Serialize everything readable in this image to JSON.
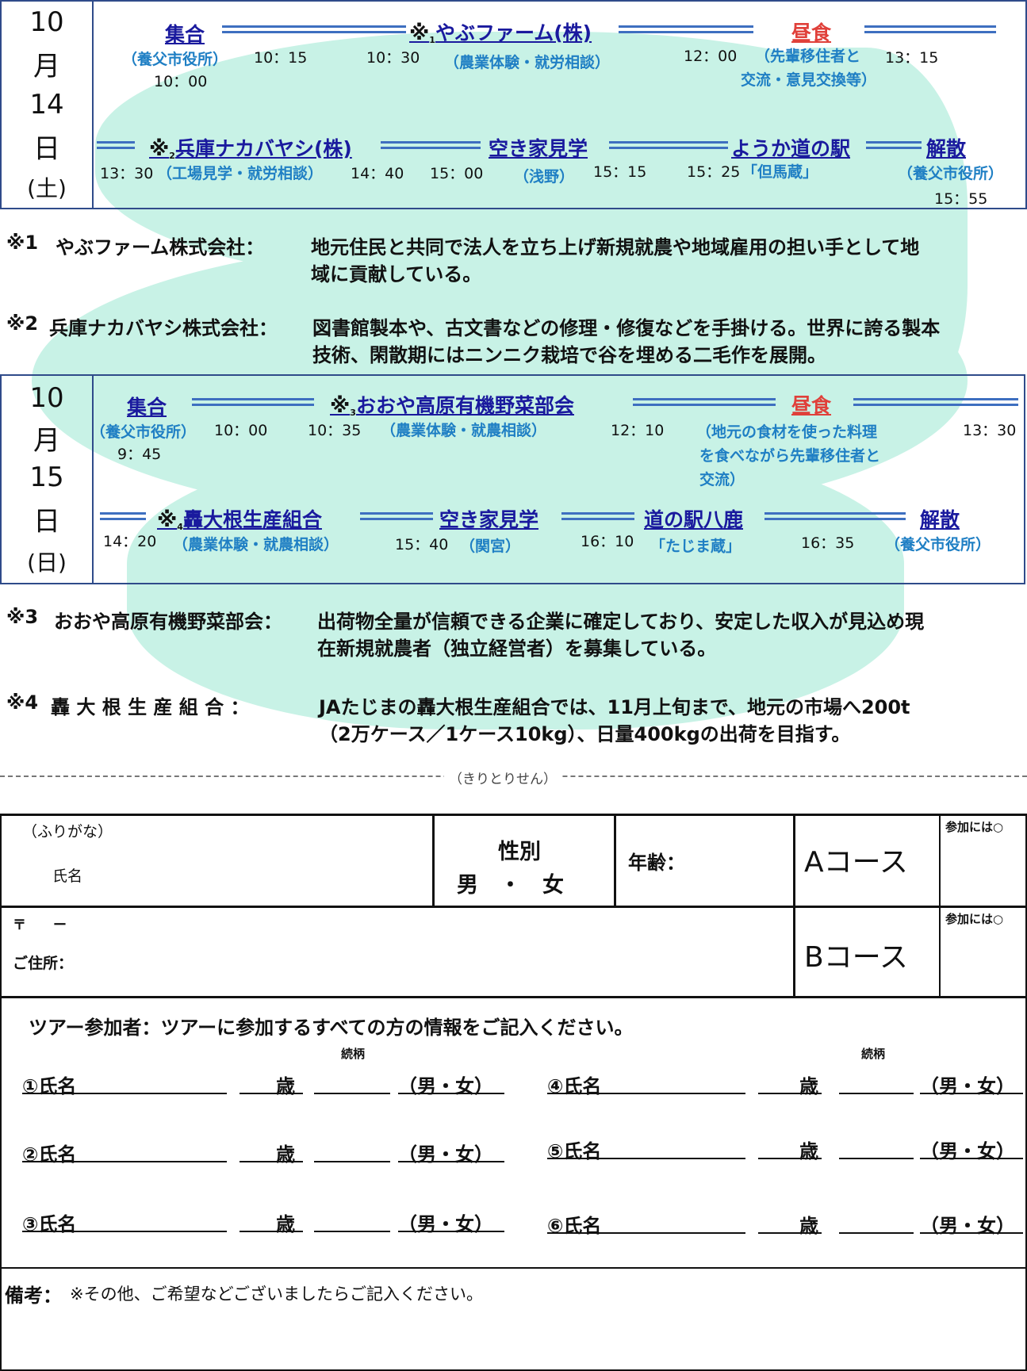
{
  "day1": {
    "date": {
      "month_num": "10",
      "month_char": "月",
      "day_num": "14",
      "day_char": "日",
      "weekday": "(土)"
    },
    "row1": {
      "stop1": {
        "label": "集合",
        "sub": "（養父市役所）",
        "time_start": "10：00",
        "time_end": "10：15"
      },
      "stop2": {
        "asterisk": "※",
        "num": "1",
        "label": "やぶファーム(株)",
        "sub": "（農業体験・就労相談）",
        "time_arrive": "10：30",
        "time_end": "12：00"
      },
      "stop3": {
        "label": "昼食",
        "sub_line1": "（先輩移住者と",
        "sub_line2": "交流・意見交換等）",
        "time_end": "13：15"
      }
    },
    "row2": {
      "stop1": {
        "asterisk": "※",
        "num": "2",
        "label": "兵庫ナカバヤシ(株)",
        "sub": "（工場見学・就労相談）",
        "time_start": "13：30",
        "time_end": "14：40"
      },
      "stop2": {
        "label": "空き家見学",
        "sub": "（浅野）",
        "time_start": "15：00",
        "time_end": "15：15"
      },
      "stop3": {
        "label": "ようか道の駅",
        "sub": "「但馬蔵」",
        "time_start": "15：25"
      },
      "stop4": {
        "label": "解散",
        "sub": "（養父市役所）",
        "time_end": "15：55"
      }
    }
  },
  "notes1": [
    {
      "mark": "※1",
      "name": "やぶファーム株式会社：",
      "line1": "地元住民と共同で法人を立ち上げ新規就農や地域雇用の担い手として地",
      "line2": "域に貢献している。"
    },
    {
      "mark": "※2",
      "name": "兵庫ナカバヤシ株式会社：",
      "line1": "図書館製本や、古文書などの修理・修復などを手掛ける。世界に誇る製本",
      "line2": "技術、閑散期にはニンニク栽培で谷を埋める二毛作を展開。"
    }
  ],
  "day2": {
    "date": {
      "month_num": "10",
      "month_char": "月",
      "day_num": "15",
      "day_char": "日",
      "weekday": "(日)"
    },
    "row1": {
      "stop1": {
        "label": "集合",
        "sub": "（養父市役所）",
        "time_start": "9：45",
        "time_end": "10：00"
      },
      "stop2": {
        "asterisk": "※",
        "num": "3",
        "label": "おおや高原有機野菜部会",
        "sub": "（農業体験・就農相談）",
        "time_arrive": "10：35",
        "time_end": "12：10"
      },
      "stop3": {
        "label": "昼食",
        "sub_line1": "（地元の食材を使った料理",
        "sub_line2": "を食べながら先輩移住者と",
        "sub_line3": "交流）",
        "time_end": "13：30"
      }
    },
    "row2": {
      "stop1": {
        "asterisk": "※",
        "num": "4",
        "label": "轟大根生産組合",
        "sub": "（農業体験・就農相談）",
        "time_start": "14：20"
      },
      "stop2": {
        "label": "空き家見学",
        "sub": "（関宮）",
        "time_start": "15：40"
      },
      "stop3": {
        "label": "道の駅八鹿",
        "sub": "「たじま蔵」",
        "time_start": "16：10"
      },
      "stop4": {
        "label": "解散",
        "sub": "（養父市役所）",
        "time_start": "16：35"
      }
    }
  },
  "notes2": [
    {
      "mark": "※3",
      "name": "おおや高原有機野菜部会：",
      "line1": "出荷物全量が信頼できる企業に確定しており、安定した収入が見込め現",
      "line2": "在新規就農者（独立経営者）を募集している。"
    },
    {
      "mark": "※4",
      "name": "轟 大 根 生 産 組 合 ：",
      "line1": "JAたじまの轟大根生産組合では、11月上旬まで、地元の市場へ200t",
      "line2": "（2万ケース／1ケース10kg）、日量400kgの出荷を目指す。"
    }
  ],
  "cutline": "（きりとりせん）",
  "form": {
    "furigana": "（ふりがな）",
    "name": "氏名",
    "gender_label": "性別",
    "gender_options": "男　・　女",
    "age": "年齢：",
    "course_a": "Aコース",
    "course_b": "Bコース",
    "join_mark": "参加には○",
    "postal": "〒　　ー",
    "address": "ご住所：",
    "participants_title": "ツアー参加者：ツアーに参加するすべての方の情報をご記入ください。",
    "relation": "続柄",
    "participants": [
      {
        "name": "①氏名"
      },
      {
        "name": "②氏名"
      },
      {
        "name": "③氏名"
      },
      {
        "name": "④氏名"
      },
      {
        "name": "⑤氏名"
      },
      {
        "name": "⑥氏名"
      }
    ],
    "age_unit": "歳",
    "gender_choice": "（男・女）",
    "remarks_label": "備考：",
    "remarks_text": "※その他、ご希望などございましたらご記入ください。"
  }
}
